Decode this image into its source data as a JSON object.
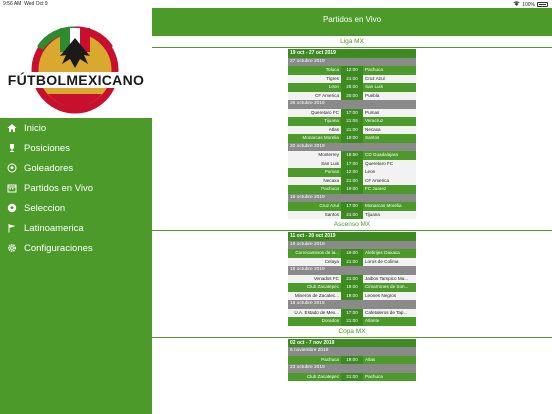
{
  "status": {
    "time": "9:56 AM",
    "date": "Wed Oct 9",
    "battery": "100%"
  },
  "logo": {
    "text": "FÚTBOLMEXICANO"
  },
  "colors": {
    "brand_green": "#4c9a2a",
    "dark_green": "#3d8a20",
    "date_gray": "#8a8a8a"
  },
  "sidebar": {
    "items": [
      {
        "label": "Inicio",
        "icon": "home-icon"
      },
      {
        "label": "Posiciones",
        "icon": "trophy-icon"
      },
      {
        "label": "Goleadores",
        "icon": "soccer-ball-icon"
      },
      {
        "label": "Partidos en Vivo",
        "icon": "calendar-icon"
      },
      {
        "label": "Seleccion",
        "icon": "soccer-ball-icon"
      },
      {
        "label": "Latinoamerica",
        "icon": "flag-icon"
      },
      {
        "label": "Configuraciones",
        "icon": "gear-icon"
      }
    ]
  },
  "header": {
    "title": "Partidos en Vivo"
  },
  "sections": [
    {
      "title": "Liga MX",
      "range": "19 oct - 27 oct 2019",
      "groups": [
        {
          "date": "27 octubre 2019",
          "matches": [
            {
              "home": "Toluca",
              "time": "12:00",
              "away": "Pachuca",
              "hg": true,
              "ag": true
            },
            {
              "home": "Tigres",
              "time": "21:00",
              "away": "Cruz Azul",
              "hg": false,
              "ag": false
            },
            {
              "home": "Leon",
              "time": "20:00",
              "away": "San Luis",
              "hg": true,
              "ag": true
            },
            {
              "home": "CF America",
              "time": "20:00",
              "away": "Puebla",
              "hg": false,
              "ag": false
            }
          ]
        },
        {
          "date": "26 octubre 2019",
          "matches": [
            {
              "home": "Queretaro FC",
              "time": "17:00",
              "away": "Pumas",
              "hg": false,
              "ag": false
            },
            {
              "home": "Tijuana",
              "time": "21:06",
              "away": "Veracruz",
              "hg": true,
              "ag": true
            },
            {
              "home": "Atlas",
              "time": "21:00",
              "away": "Necaxa",
              "hg": false,
              "ag": false
            },
            {
              "home": "Monarcas Morelia",
              "time": "19:00",
              "away": "Santos",
              "hg": true,
              "ag": true
            }
          ]
        },
        {
          "date": "20 octubre 2019",
          "matches": [
            {
              "home": "Monterrey",
              "time": "18:50",
              "away": "CD Guadalajara",
              "hg": false,
              "ag": true
            },
            {
              "home": "San Luis",
              "time": "17:00",
              "away": "Queretaro FC",
              "hg": false,
              "ag": false
            },
            {
              "home": "Pumas",
              "time": "12:00",
              "away": "Leon",
              "hg": true,
              "ag": false
            },
            {
              "home": "Necaxa",
              "time": "21:00",
              "away": "CF America",
              "hg": false,
              "ag": false
            },
            {
              "home": "Pachuca",
              "time": "19:00",
              "away": "FC Juarez",
              "hg": true,
              "ag": true
            }
          ]
        },
        {
          "date": "19 octubre 2019",
          "matches": [
            {
              "home": "Cruz Azul",
              "time": "17:00",
              "away": "Monarcas Morelia",
              "hg": true,
              "ag": true
            },
            {
              "home": "Santos",
              "time": "21:00",
              "away": "Tijuana",
              "hg": false,
              "ag": false
            }
          ]
        }
      ]
    },
    {
      "title": "Ascenso MX",
      "range": "11 oct - 20 oct 2019",
      "groups": [
        {
          "date": "19 octubre 2019",
          "matches": [
            {
              "home": "Correcaminos de la...",
              "time": "19:00",
              "away": "Alebrijes Oaxaca",
              "hg": true,
              "ag": true
            },
            {
              "home": "Celaya",
              "time": "21:00",
              "away": "Loros de Colima",
              "hg": false,
              "ag": false
            }
          ]
        },
        {
          "date": "18 octubre 2019",
          "matches": [
            {
              "home": "Venados FC",
              "time": "21:00",
              "away": "Jaibos Tampico Ma...",
              "hg": false,
              "ag": false
            },
            {
              "home": "Club Zacatepec",
              "time": "19:00",
              "away": "Cimarrones de Son...",
              "hg": true,
              "ag": true
            },
            {
              "home": "Mineros de Zacatec...",
              "time": "19:00",
              "away": "Leones Negros",
              "hg": false,
              "ag": false
            }
          ]
        },
        {
          "date": "18 octubre 2019",
          "matches": [
            {
              "home": "U.A. Estado de Mex...",
              "time": "17:00",
              "away": "Cafetaleros de Tap...",
              "hg": false,
              "ag": false
            },
            {
              "home": "Dorados",
              "time": "21:00",
              "away": "Atlante",
              "hg": true,
              "ag": true
            }
          ]
        }
      ]
    },
    {
      "title": "Copa MX",
      "range": "02 oct - 7 nov 2019",
      "groups": [
        {
          "date": "6 noviembre 2019",
          "matches": [
            {
              "home": "Pachuca",
              "time": "19:00",
              "away": "Atlas",
              "hg": true,
              "ag": true
            }
          ]
        },
        {
          "date": "23 octubre 2019",
          "matches": [
            {
              "home": "Club Zacatepec",
              "time": "21:00",
              "away": "Pachuca",
              "hg": true,
              "ag": true
            }
          ]
        }
      ]
    }
  ]
}
